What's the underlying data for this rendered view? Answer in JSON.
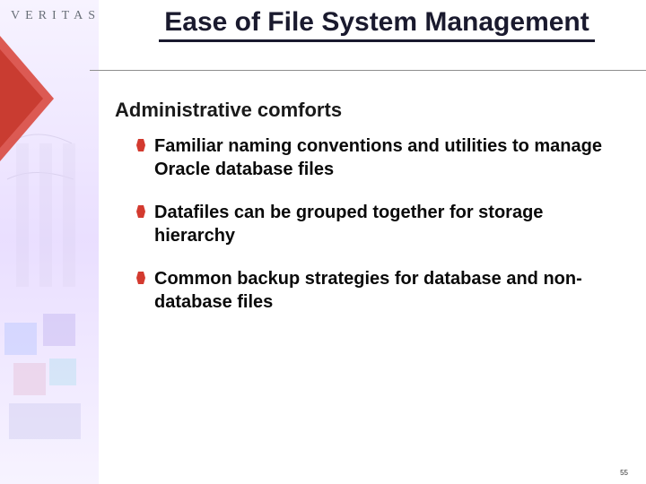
{
  "logo": {
    "text": "VERITAS"
  },
  "title": "Ease of File System Management",
  "section_heading": "Administrative comforts",
  "bullets": [
    {
      "text": "Familiar naming conventions and utilities to manage Oracle database files"
    },
    {
      "text": "Datafiles can be grouped together for storage hierarchy"
    },
    {
      "text": "Common backup strategies for database and non-database files"
    }
  ],
  "page_number": "55",
  "colors": {
    "accent": "#d33a2f",
    "title": "#1a1a2e",
    "rule": "#8f8f8f",
    "logo": "#686f78"
  }
}
